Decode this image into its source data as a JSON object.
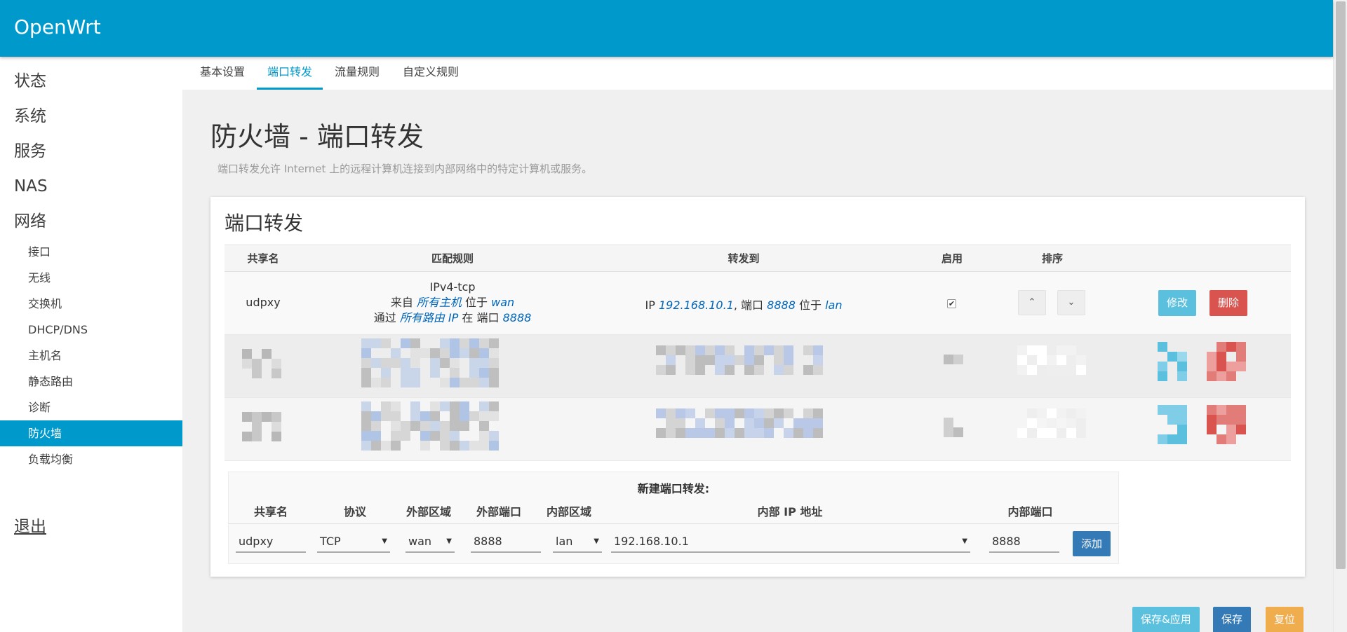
{
  "brand": "OpenWrt",
  "sidebar": {
    "top_items": [
      "状态",
      "系统",
      "服务",
      "NAS",
      "网络"
    ],
    "sub_items": [
      "接口",
      "无线",
      "交换机",
      "DHCP/DNS",
      "主机名",
      "静态路由",
      "诊断",
      "防火墙",
      "负载均衡"
    ],
    "active": "防火墙",
    "logout": "退出"
  },
  "tabs": [
    "基本设置",
    "端口转发",
    "流量规则",
    "自定义规则"
  ],
  "active_tab": "端口转发",
  "page": {
    "title": "防火墙 - 端口转发",
    "description": "端口转发允许 Internet 上的远程计算机连接到内部网络中的特定计算机或服务。"
  },
  "section": {
    "title": "端口转发",
    "columns": [
      "共享名",
      "匹配规则",
      "转发到",
      "启用",
      "排序"
    ],
    "rule": {
      "name": "udpxy",
      "proto": "IPv4-tcp",
      "from_prefix": "来自",
      "from_host": "所有主机",
      "located": "位于",
      "src_zone": "wan",
      "via_prefix": "通过",
      "via_target": "所有路由 IP",
      "at": "在",
      "port_word": "端口",
      "ext_port": "8888",
      "ip_word": "IP",
      "dest_ip": "192.168.10.1",
      "comma_port": ", 端口",
      "dest_port": "8888",
      "dest_zone": "lan",
      "enabled": true,
      "up": "⌃",
      "down": "⌄",
      "edit": "修改",
      "delete": "删除"
    }
  },
  "new_rule": {
    "title": "新建端口转发:",
    "columns": [
      "共享名",
      "协议",
      "外部区域",
      "外部端口",
      "内部区域",
      "内部 IP 地址",
      "内部端口"
    ],
    "name": "udpxy",
    "protocol": "TCP",
    "external_zone": "wan",
    "external_port": "8888",
    "internal_zone": "lan",
    "internal_ip": "192.168.10.1",
    "internal_port": "8888",
    "add": "添加"
  },
  "actions": {
    "save_apply": "保存&应用",
    "save": "保存",
    "reset": "复位"
  },
  "colors": {
    "header": "#0099cc",
    "edit": "#5bc0de",
    "delete": "#d9534f",
    "primary": "#337ab7",
    "reset": "#f0ad4e"
  }
}
